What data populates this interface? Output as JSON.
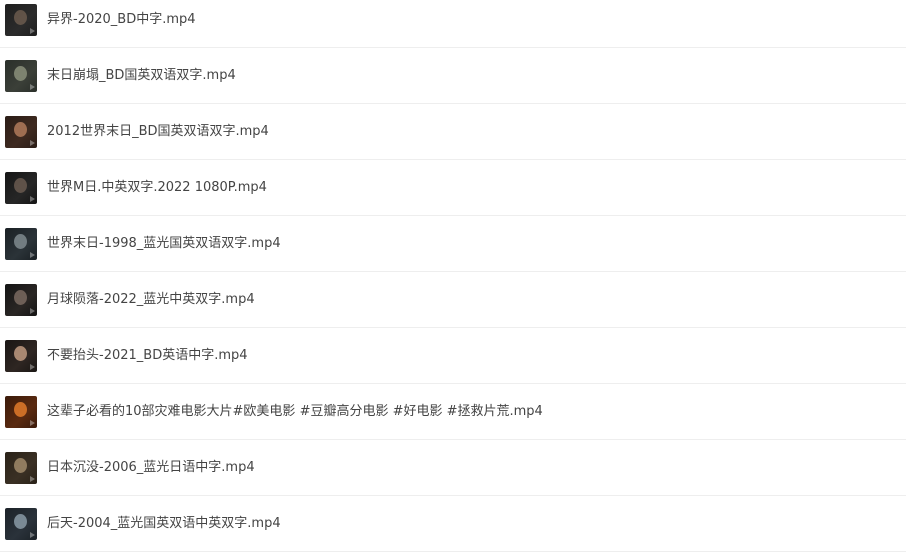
{
  "files": [
    {
      "name": "异界-2020_BD中字.mp4",
      "thumb_colors": [
        "#1e1e1e",
        "#6b5a4e",
        "#2b2b2b"
      ]
    },
    {
      "name": "末日崩塌_BD国英双语双字.mp4",
      "thumb_colors": [
        "#2a2f2a",
        "#8a8f7a",
        "#3b3f38"
      ]
    },
    {
      "name": "2012世界末日_BD国英双语双字.mp4",
      "thumb_colors": [
        "#2a1c16",
        "#b07a5a",
        "#3e2a20"
      ]
    },
    {
      "name": "世界M日.中英双字.2022 1080P.mp4",
      "thumb_colors": [
        "#151515",
        "#6a5a50",
        "#262626"
      ]
    },
    {
      "name": "世界末日-1998_蓝光国英双语双字.mp4",
      "thumb_colors": [
        "#1a2024",
        "#7f8a8e",
        "#2b3338"
      ]
    },
    {
      "name": "月球陨落-2022_蓝光中英双字.mp4",
      "thumb_colors": [
        "#141414",
        "#7a6a60",
        "#2a2624"
      ]
    },
    {
      "name": "不要抬头-2021_BD英语中字.mp4",
      "thumb_colors": [
        "#1a1614",
        "#c09a80",
        "#2e2622"
      ]
    },
    {
      "name": "这辈子必看的10部灾难电影大片#欧美电影 #豆瓣高分电影 #好电影 #拯救片荒.mp4",
      "thumb_colors": [
        "#3a1a0a",
        "#e07a2a",
        "#5a2a10"
      ]
    },
    {
      "name": "日本沉没-2006_蓝光日语中字.mp4",
      "thumb_colors": [
        "#2a2218",
        "#a08a6a",
        "#3a3024"
      ]
    },
    {
      "name": "后天-2004_蓝光国英双语中英双字.mp4",
      "thumb_colors": [
        "#1c2228",
        "#8a9aa6",
        "#2a323a"
      ]
    }
  ]
}
